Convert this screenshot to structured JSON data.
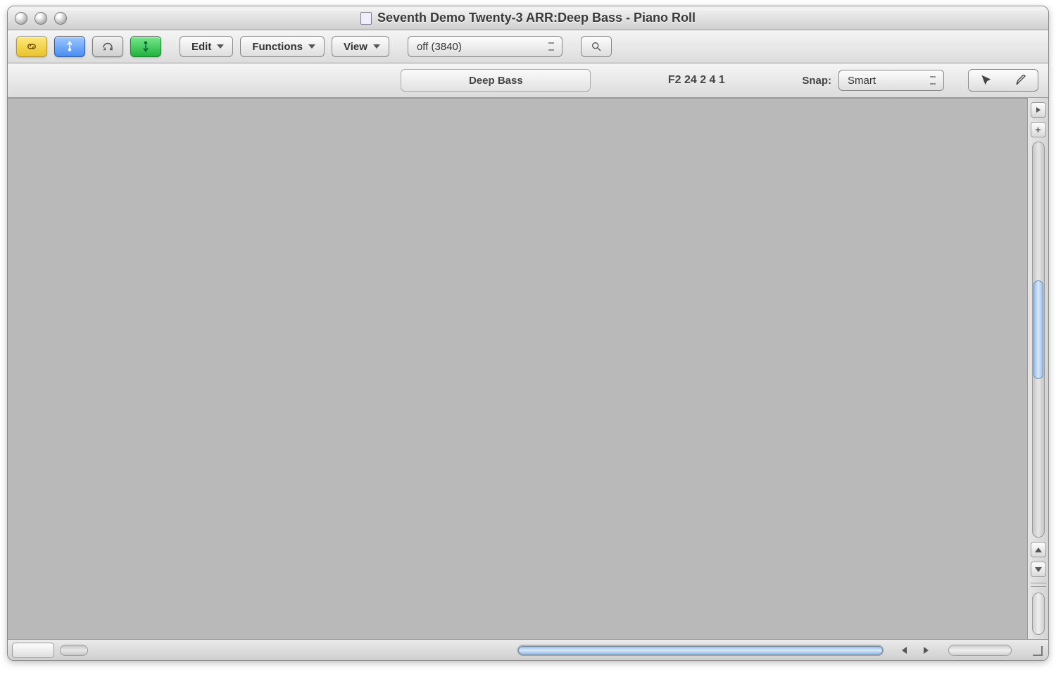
{
  "window": {
    "title": "Seventh Demo Twenty-3 ARR:Deep Bass - Piano Roll"
  },
  "toolbar": {
    "menus": {
      "edit": "Edit",
      "functions": "Functions",
      "view": "View"
    },
    "quantize": "off (3840)"
  },
  "subtoolbar": {
    "region_name": "Deep Bass",
    "position": "F2   24 2 4 1",
    "snap_label": "Snap:",
    "snap_value": "Smart"
  }
}
